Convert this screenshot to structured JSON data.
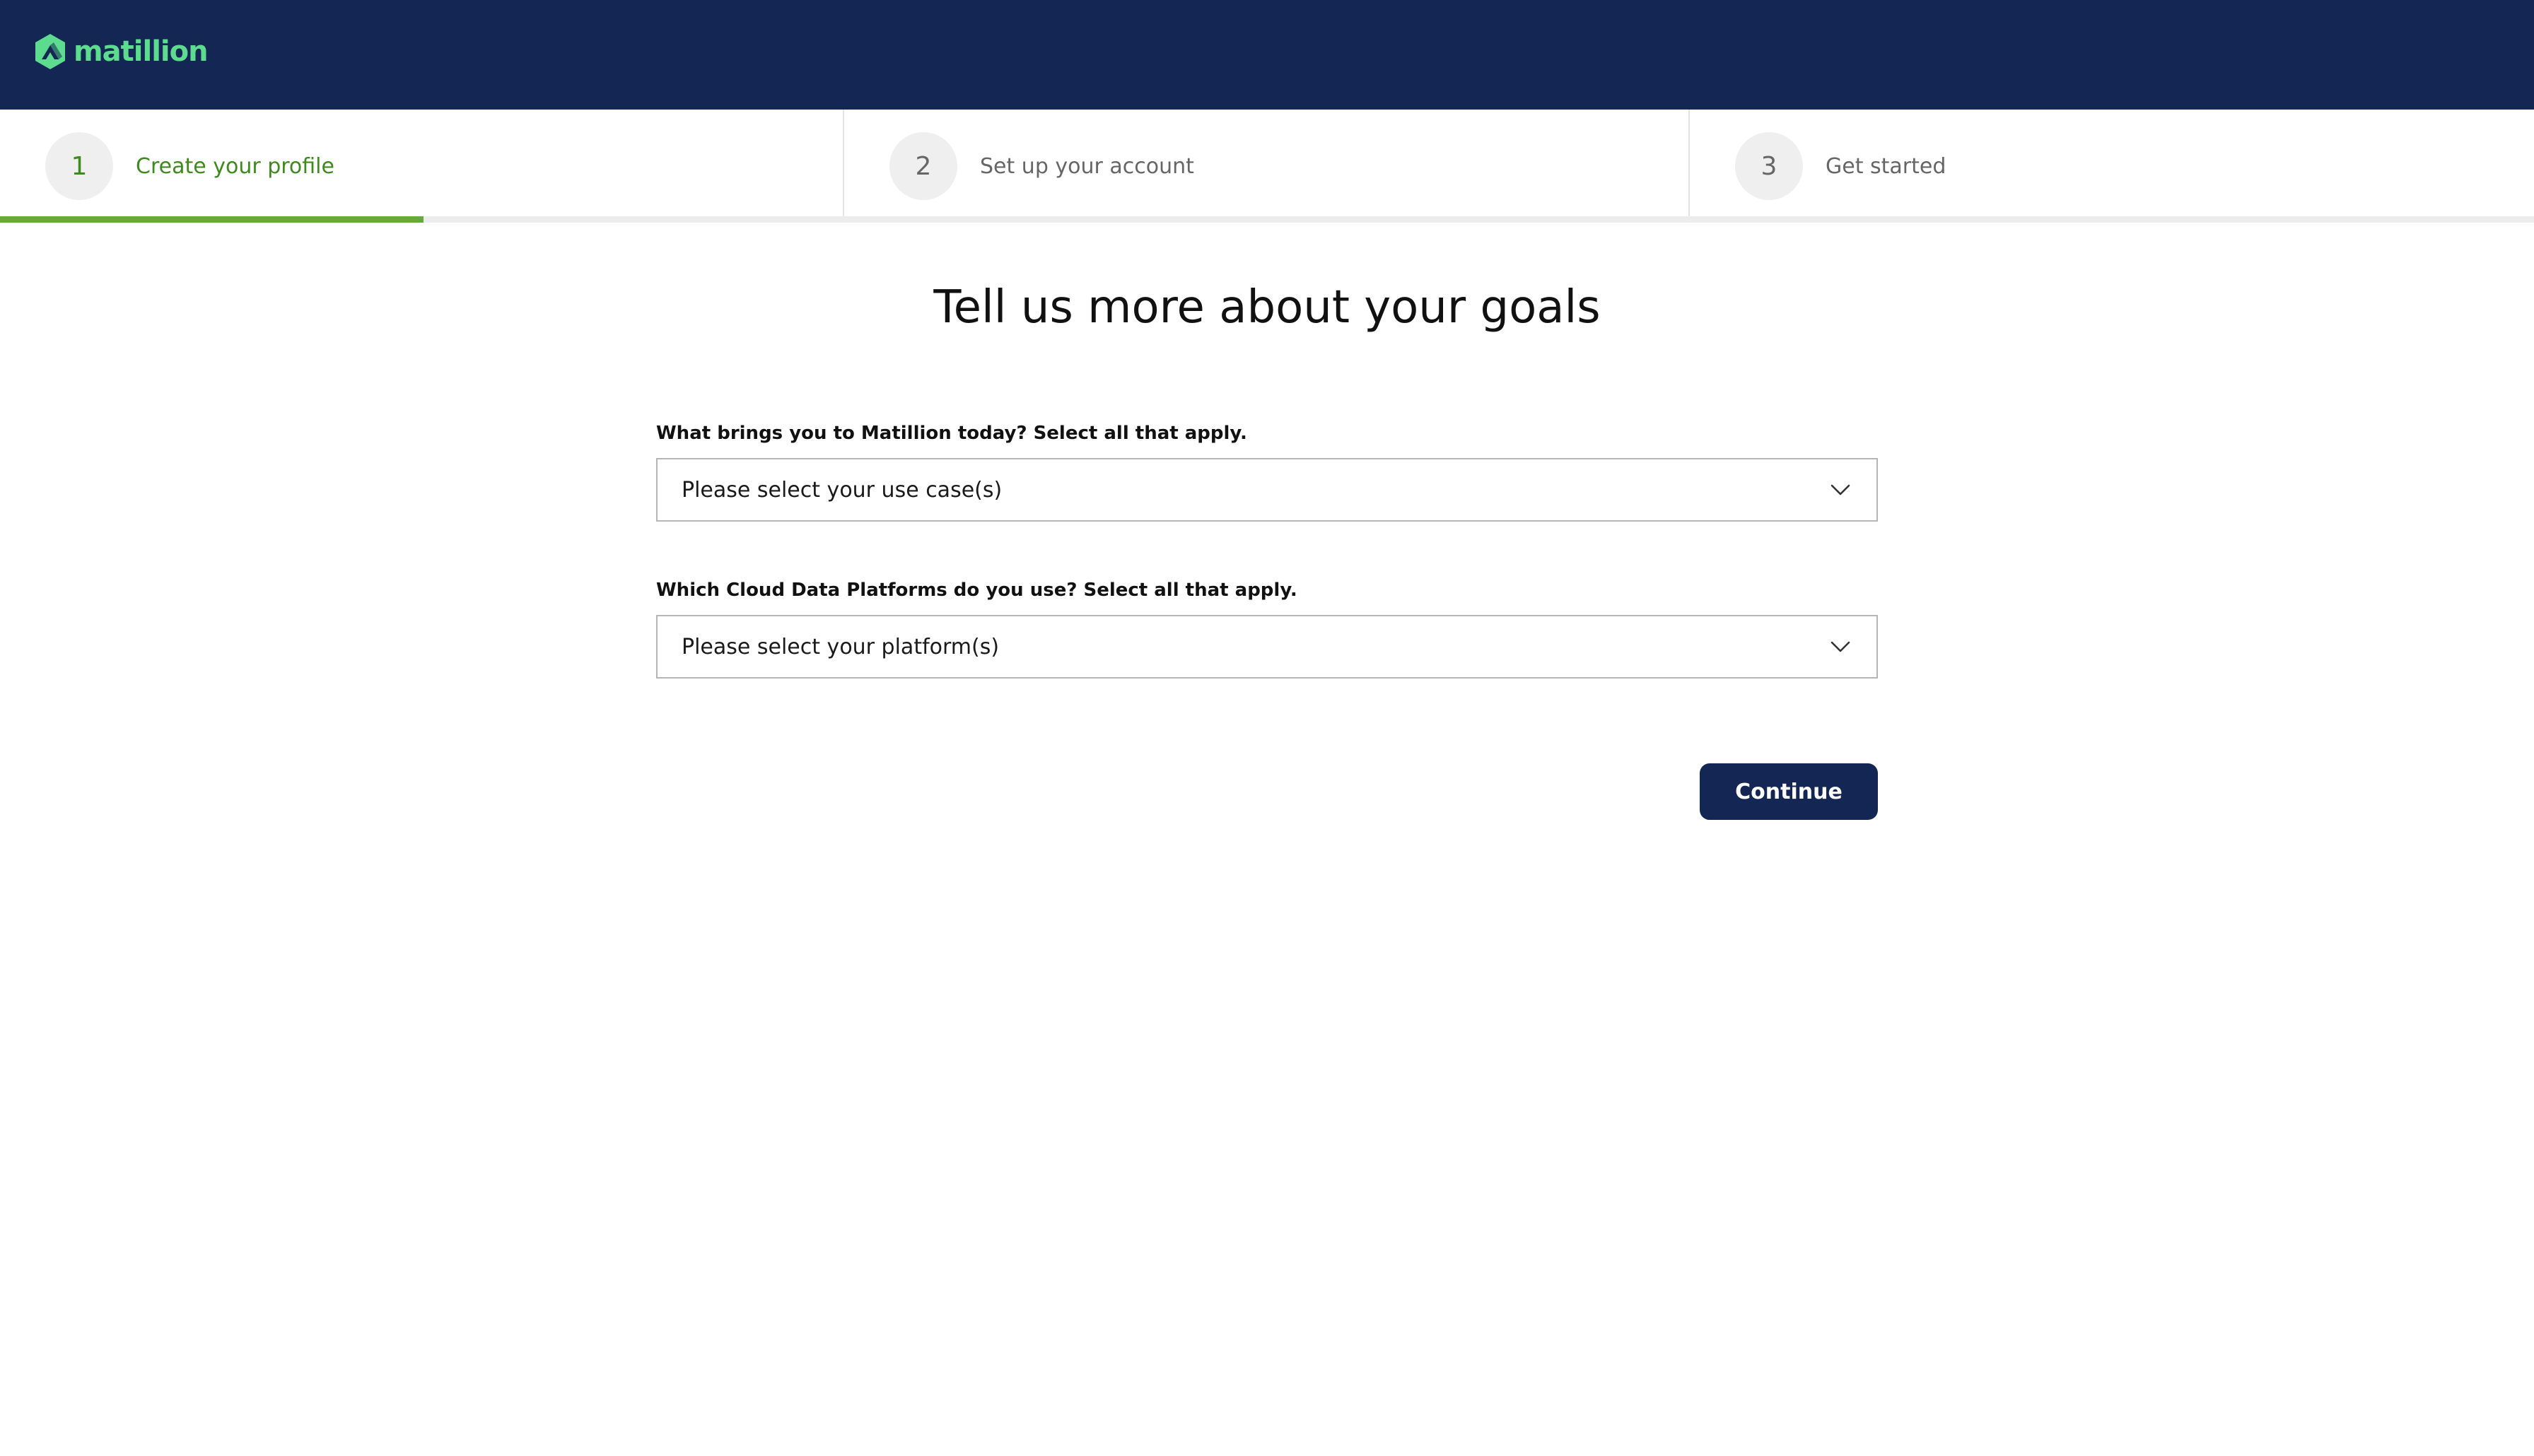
{
  "brand": {
    "name": "matillion",
    "logo_icon": "matillion-logo-icon",
    "header_color": "#142654",
    "accent_color": "#5ddc8f"
  },
  "stepper": {
    "steps": [
      {
        "number": "1",
        "label": "Create your profile",
        "state": "active"
      },
      {
        "number": "2",
        "label": "Set up your account",
        "state": "inactive"
      },
      {
        "number": "3",
        "label": "Get started",
        "state": "inactive"
      }
    ],
    "progress_fraction": 0.167,
    "active_color": "#3f8a1f",
    "progress_color": "#62ab3c"
  },
  "main": {
    "title": "Tell us more about your goals",
    "use_case": {
      "label": "What brings you to Matillion today? Select all that apply.",
      "placeholder": "Please select your use case(s)",
      "icon": "chevron-down-icon"
    },
    "platform": {
      "label": "Which Cloud Data Platforms do you use? Select all that apply.",
      "placeholder": "Please select your platform(s)",
      "icon": "chevron-down-icon"
    },
    "continue_label": "Continue"
  }
}
